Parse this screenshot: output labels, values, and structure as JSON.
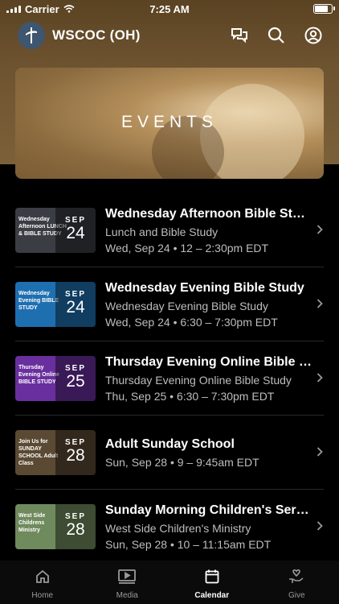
{
  "status": {
    "carrier": "Carrier",
    "time": "7:25 AM",
    "battery_level": 0.95
  },
  "app": {
    "title": "WSCOC (OH)",
    "icons": [
      "chat-icon",
      "search-icon",
      "account-icon"
    ]
  },
  "banner": {
    "title": "EVENTS"
  },
  "events": [
    {
      "title": "Wednesday Afternoon Bible Study",
      "subtitle": "Lunch and Bible Study",
      "time": "Wed, Sep 24 • 12 – 2:30pm EDT",
      "month": "SEP",
      "day": "24",
      "thumb_text": "Wednesday Afternoon LUNCH & BIBLE STUDY",
      "thumb_color": "#3a3d44"
    },
    {
      "title": "Wednesday Evening Bible Study",
      "subtitle": "Wednesday Evening Bible Study",
      "time": "Wed, Sep 24 • 6:30 – 7:30pm EDT",
      "month": "SEP",
      "day": "24",
      "thumb_text": "Wednesday Evening BIBLE STUDY",
      "thumb_color": "#1e6fb0"
    },
    {
      "title": "Thursday Evening Online Bible Study",
      "subtitle": "Thursday Evening Online Bible Study",
      "time": "Thu, Sep 25 • 6:30 – 7:30pm EDT",
      "month": "SEP",
      "day": "25",
      "thumb_text": "Thursday Evening Online BIBLE STUDY",
      "thumb_color": "#6a2f9e"
    },
    {
      "title": "Adult Sunday School",
      "subtitle": "",
      "time": "Sun, Sep 28 • 9 – 9:45am EDT",
      "month": "SEP",
      "day": "28",
      "thumb_text": "Join Us for SUNDAY SCHOOL Adult Class",
      "thumb_color": "#5b4a33"
    },
    {
      "title": "Sunday Morning Children's Service",
      "subtitle": "West Side Children's Ministry",
      "time": "Sun, Sep 28 • 10 – 11:15am EDT",
      "month": "SEP",
      "day": "28",
      "thumb_text": "West Side Childrens Ministry",
      "thumb_color": "#6f8a5c"
    }
  ],
  "tabs": [
    {
      "label": "Home",
      "icon": "home-icon",
      "active": false
    },
    {
      "label": "Media",
      "icon": "media-icon",
      "active": false
    },
    {
      "label": "Calendar",
      "icon": "calendar-icon",
      "active": true
    },
    {
      "label": "Give",
      "icon": "give-icon",
      "active": false
    }
  ]
}
